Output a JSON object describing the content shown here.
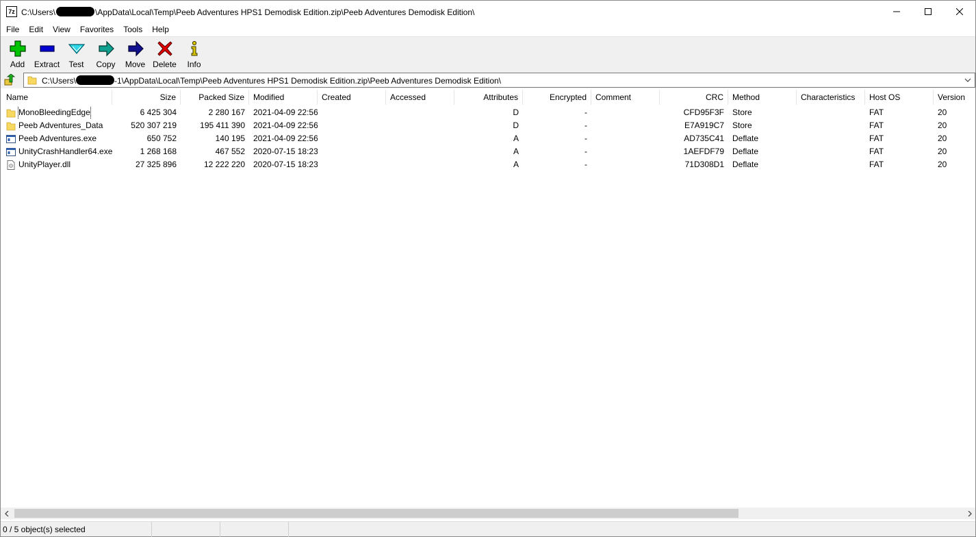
{
  "window": {
    "app_icon_text": "7z",
    "title_prefix": "C:\\Users\\",
    "title_suffix": "\\AppData\\Local\\Temp\\Peeb Adventures HPS1 Demodisk Edition.zip\\Peeb Adventures Demodisk Edition\\"
  },
  "menu": [
    "File",
    "Edit",
    "View",
    "Favorites",
    "Tools",
    "Help"
  ],
  "toolbar": [
    {
      "label": "Add",
      "icon": "plus-icon",
      "color": "#00c000"
    },
    {
      "label": "Extract",
      "icon": "minus-icon",
      "color": "#0000c0"
    },
    {
      "label": "Test",
      "icon": "check-icon",
      "color": "#00b0c0"
    },
    {
      "label": "Copy",
      "icon": "copy-arrow-icon",
      "color": "#008080"
    },
    {
      "label": "Move",
      "icon": "move-arrow-icon",
      "color": "#000090"
    },
    {
      "label": "Delete",
      "icon": "x-icon",
      "color": "#e00000"
    },
    {
      "label": "Info",
      "icon": "info-icon",
      "color": "#c8b400"
    }
  ],
  "address": {
    "prefix": "C:\\Users\\",
    "suffix": "-1\\AppData\\Local\\Temp\\Peeb Adventures HPS1 Demodisk Edition.zip\\Peeb Adventures Demodisk Edition\\"
  },
  "columns": [
    "Name",
    "Size",
    "Packed Size",
    "Modified",
    "Created",
    "Accessed",
    "Attributes",
    "Encrypted",
    "Comment",
    "CRC",
    "Method",
    "Characteristics",
    "Host OS",
    "Version"
  ],
  "files": [
    {
      "name": "MonoBleedingEdge",
      "type": "folder",
      "size": "6 425 304",
      "packed": "2 280 167",
      "modified": "2021-04-09 22:56",
      "created": "",
      "accessed": "",
      "attributes": "D",
      "encrypted": "-",
      "comment": "",
      "crc": "CFD95F3F",
      "method": "Store",
      "characteristics": "",
      "host_os": "FAT",
      "version": "20"
    },
    {
      "name": "Peeb Adventures_Data",
      "type": "folder",
      "size": "520 307 219",
      "packed": "195 411 390",
      "modified": "2021-04-09 22:56",
      "created": "",
      "accessed": "",
      "attributes": "D",
      "encrypted": "-",
      "comment": "",
      "crc": "E7A919C7",
      "method": "Store",
      "characteristics": "",
      "host_os": "FAT",
      "version": "20"
    },
    {
      "name": "Peeb Adventures.exe",
      "type": "exe",
      "size": "650 752",
      "packed": "140 195",
      "modified": "2021-04-09 22:56",
      "created": "",
      "accessed": "",
      "attributes": "A",
      "encrypted": "-",
      "comment": "",
      "crc": "AD735C41",
      "method": "Deflate",
      "characteristics": "",
      "host_os": "FAT",
      "version": "20"
    },
    {
      "name": "UnityCrashHandler64.exe",
      "type": "exe",
      "size": "1 268 168",
      "packed": "467 552",
      "modified": "2020-07-15 18:23",
      "created": "",
      "accessed": "",
      "attributes": "A",
      "encrypted": "-",
      "comment": "",
      "crc": "1AEFDF79",
      "method": "Deflate",
      "characteristics": "",
      "host_os": "FAT",
      "version": "20"
    },
    {
      "name": "UnityPlayer.dll",
      "type": "dll",
      "size": "27 325 896",
      "packed": "12 222 220",
      "modified": "2020-07-15 18:23",
      "created": "",
      "accessed": "",
      "attributes": "A",
      "encrypted": "-",
      "comment": "",
      "crc": "71D308D1",
      "method": "Deflate",
      "characteristics": "",
      "host_os": "FAT",
      "version": "20"
    }
  ],
  "status": {
    "selection": "0 / 5 object(s) selected"
  }
}
